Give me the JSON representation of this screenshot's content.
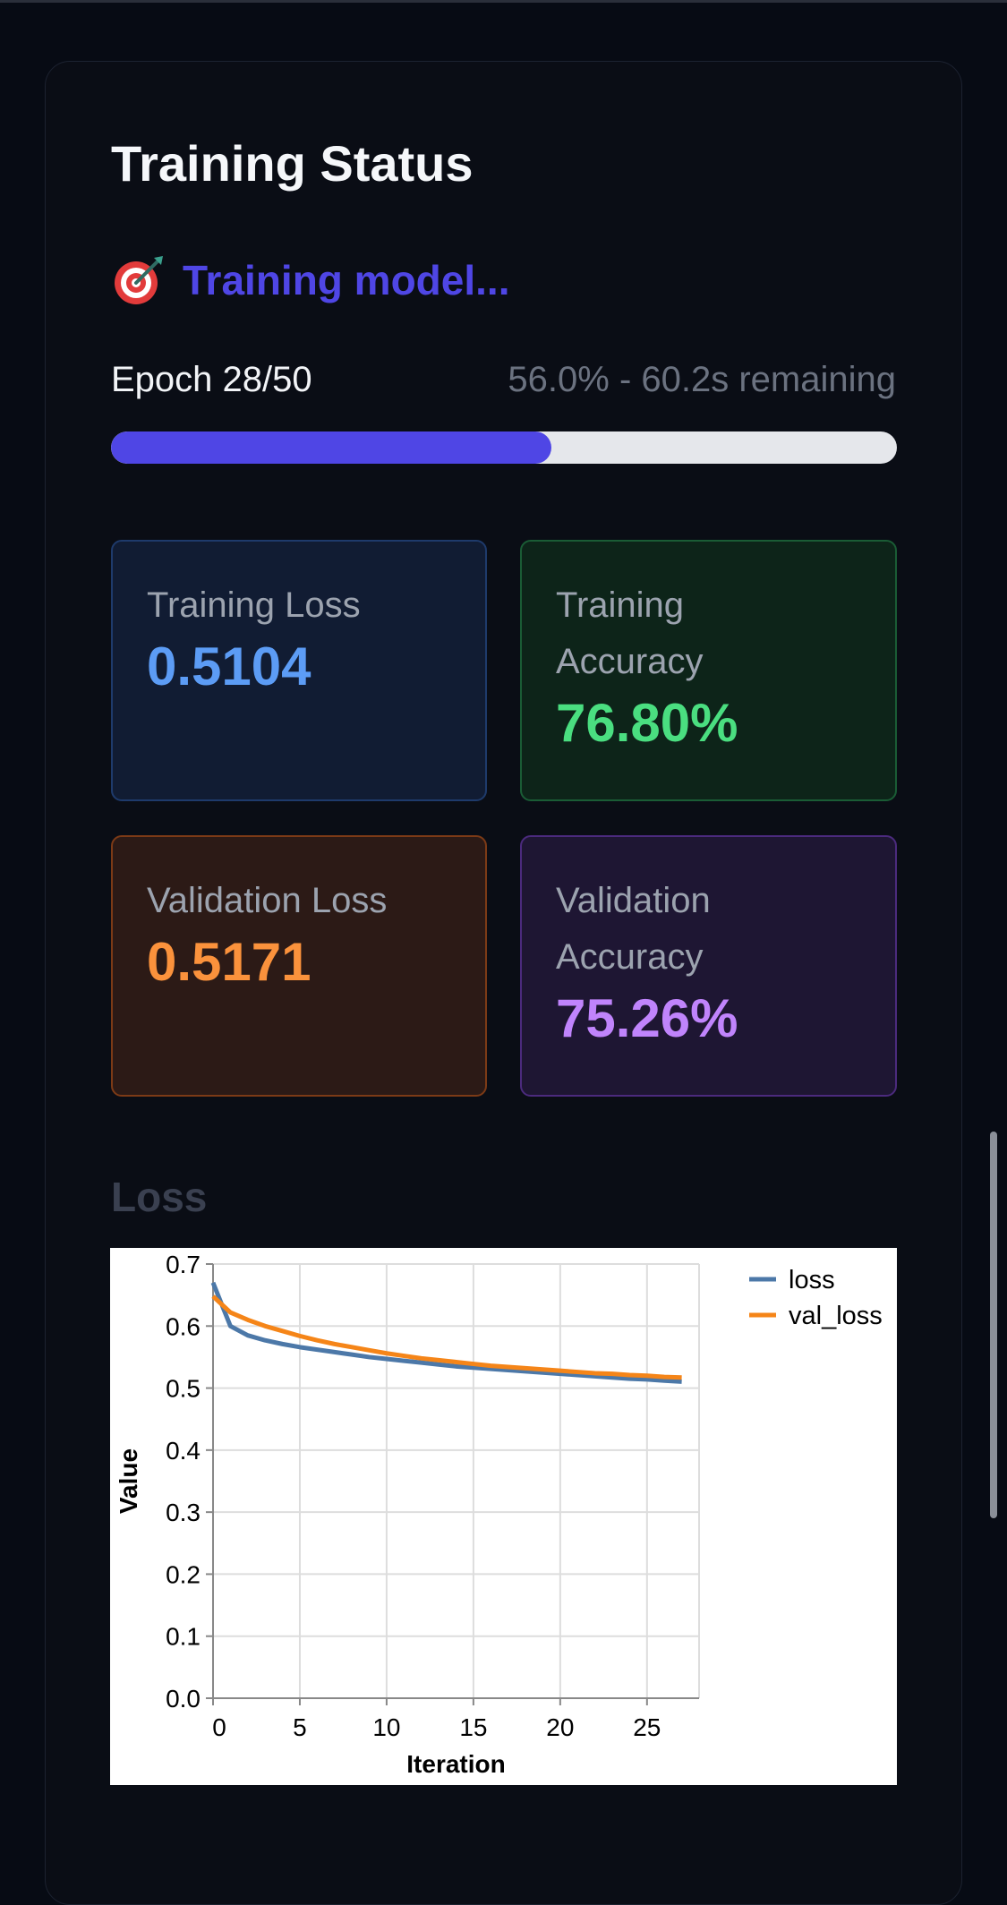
{
  "page": {
    "title": "Training Status",
    "status_icon": "target-icon",
    "status_text": "Training model...",
    "epoch_text": "Epoch 28/50",
    "progress_text": "56.0% - 60.2s remaining",
    "progress_fraction": 0.56,
    "accent_color": "#4f46e5"
  },
  "metrics": [
    {
      "label": "Training Loss",
      "value": "0.5104",
      "color": "#5c9cf5"
    },
    {
      "label": "Training Accuracy",
      "value": "76.80%",
      "color": "#4ade80"
    },
    {
      "label": "Validation Loss",
      "value": "0.5171",
      "color": "#fb923c"
    },
    {
      "label": "Validation Accuracy",
      "value": "75.26%",
      "color": "#c084fc"
    }
  ],
  "loss_section": {
    "title": "Loss"
  },
  "chart_data": {
    "type": "line",
    "title": "",
    "xlabel": "Iteration",
    "ylabel": "Value",
    "xlim": [
      0,
      28
    ],
    "ylim": [
      0,
      0.7
    ],
    "x_ticks": [
      0,
      5,
      10,
      15,
      20,
      25
    ],
    "y_ticks": [
      0.0,
      0.1,
      0.2,
      0.3,
      0.4,
      0.5,
      0.6,
      0.7
    ],
    "grid": true,
    "legend": "top-right",
    "x": [
      0,
      1,
      2,
      3,
      4,
      5,
      6,
      7,
      8,
      9,
      10,
      11,
      12,
      13,
      14,
      15,
      16,
      17,
      18,
      19,
      20,
      21,
      22,
      23,
      24,
      25,
      26,
      27
    ],
    "series": [
      {
        "name": "loss",
        "color": "#4c78a8",
        "values": [
          0.67,
          0.6,
          0.585,
          0.577,
          0.571,
          0.566,
          0.562,
          0.558,
          0.554,
          0.55,
          0.547,
          0.544,
          0.541,
          0.538,
          0.535,
          0.533,
          0.531,
          0.529,
          0.527,
          0.525,
          0.523,
          0.521,
          0.519,
          0.517,
          0.515,
          0.514,
          0.512,
          0.5104
        ]
      },
      {
        "name": "val_loss",
        "color": "#f58518",
        "values": [
          0.648,
          0.622,
          0.61,
          0.6,
          0.592,
          0.584,
          0.577,
          0.571,
          0.566,
          0.561,
          0.556,
          0.552,
          0.548,
          0.545,
          0.542,
          0.539,
          0.536,
          0.534,
          0.532,
          0.53,
          0.528,
          0.526,
          0.524,
          0.523,
          0.521,
          0.52,
          0.518,
          0.5171
        ]
      }
    ]
  }
}
